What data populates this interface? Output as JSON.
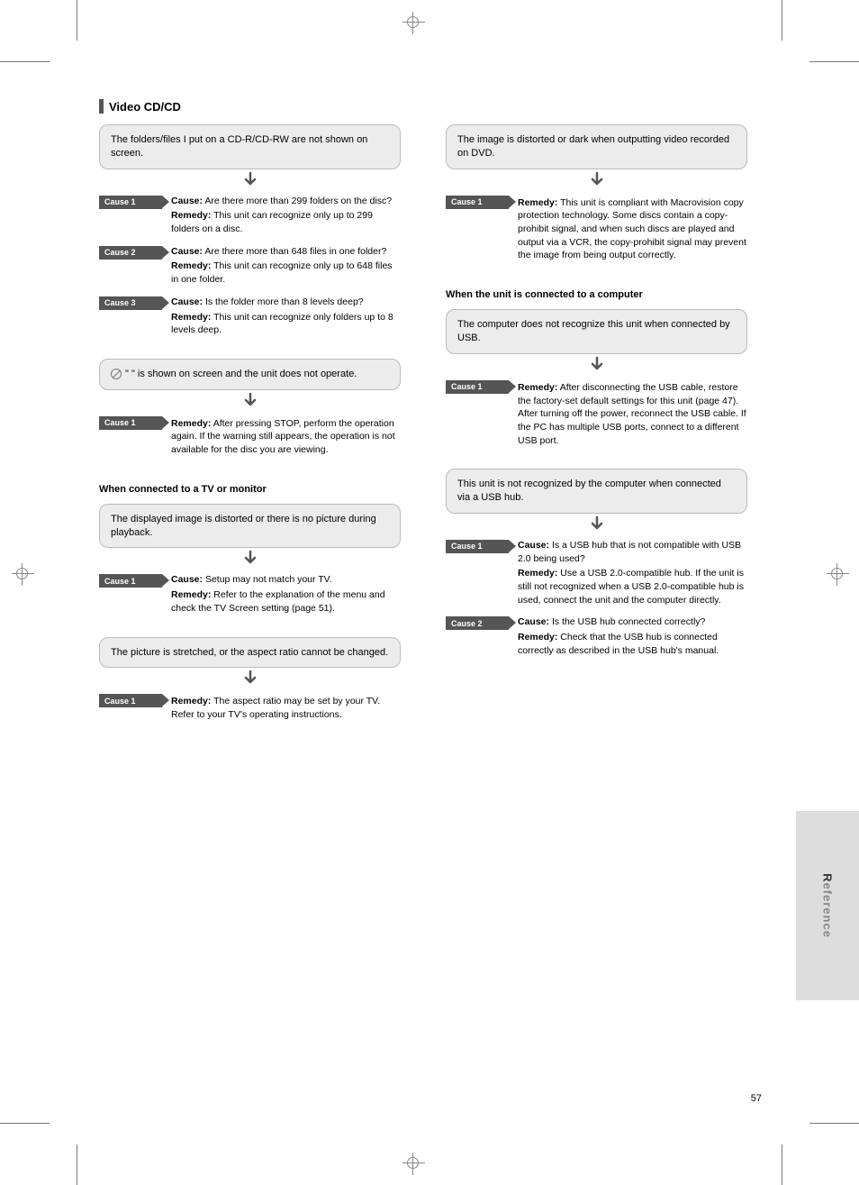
{
  "pageNumber": "57",
  "sideTab": {
    "first": "R",
    "rest": "eference"
  },
  "section": {
    "title": "Video CD/CD"
  },
  "subheadRight": "When the unit is connected to a computer",
  "left": [
    {
      "symptom": "The folders/files I put on a CD-R/CD-RW are not shown on screen.",
      "causes": [
        {
          "cause": "Are there more than 299 folders on the disc?",
          "remedy": "This unit can recognize only up to 299 folders on a disc."
        },
        {
          "cause": "Are there more than 648 files in one folder?",
          "remedy": "This unit can recognize only up to 648 files in one folder."
        },
        {
          "cause": "Is the folder more than 8 levels deep?",
          "remedy": "This unit can recognize only folders up to 8 levels deep."
        }
      ]
    },
    {
      "symptomHasIcon": true,
      "symptom": "\"      \" is shown on screen and the unit does not operate.",
      "causes": [
        {
          "cause": "",
          "remedy": "After pressing STOP, perform the operation again. If the warning still appears, the operation is not available for the disc you are viewing."
        }
      ]
    },
    {
      "subhead": "When connected to a TV or monitor"
    },
    {
      "symptom": "The displayed image is distorted or there is no picture during playback.",
      "causes": [
        {
          "cause": "Setup may not match your TV.",
          "remedy": "Refer to the explanation of the menu and check the TV Screen setting (page 51)."
        }
      ]
    },
    {
      "symptom": "The picture is stretched, or the aspect ratio cannot be changed.",
      "causes": [
        {
          "cause": "",
          "remedy": "The aspect ratio may be set by your TV. Refer to your TV's operating instructions."
        }
      ]
    }
  ],
  "right": [
    {
      "symptom": "The image is distorted or dark when outputting video recorded on DVD.",
      "causes": [
        {
          "cause": "",
          "remedy": "This unit is compliant with Macrovision copy protection technology. Some discs contain a copy-prohibit signal, and when such discs are played and output via a VCR, the copy-prohibit signal may prevent the image from being output correctly."
        }
      ]
    },
    {
      "subhead": true
    },
    {
      "symptom": "The computer does not recognize this unit when connected by USB.",
      "causes": [
        {
          "cause": "",
          "remedy": "After disconnecting the USB cable, restore the factory-set default settings for this unit (page 47). After turning off the power, reconnect the USB cable. If the PC has multiple USB ports, connect to a different USB port."
        }
      ]
    },
    {
      "symptom": "This unit is not recognized by the computer when connected via a USB hub.",
      "causes": [
        {
          "cause": "Is a USB hub that is not compatible with USB 2.0 being used?",
          "remedy": "Use a USB 2.0-compatible hub. If the unit is still not recognized when a USB 2.0-compatible hub is used, connect the unit and the computer directly."
        },
        {
          "cause": "Is the USB hub connected correctly?",
          "remedy": "Check that the USB hub is connected correctly as described in the USB hub's manual."
        }
      ]
    }
  ],
  "labels": {
    "cause": "Cause:",
    "remedy": "Remedy:",
    "causeTag": "Cause 1",
    "causeTag2": "Cause 2",
    "causeTag3": "Cause 3"
  }
}
